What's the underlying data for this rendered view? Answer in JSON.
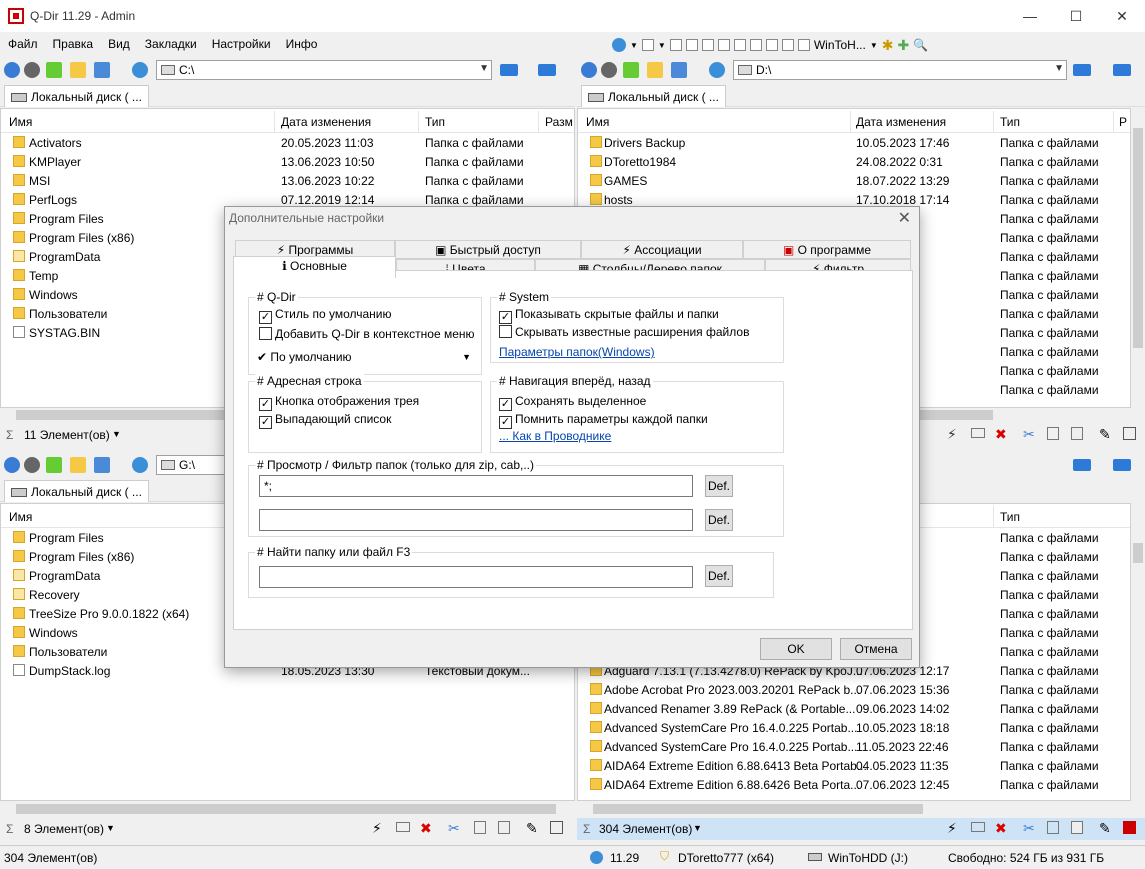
{
  "window": {
    "title": "Q-Dir 11.29 - Admin",
    "minimize": "—",
    "maximize": "☐",
    "close": "✕"
  },
  "menu": [
    "Файл",
    "Правка",
    "Вид",
    "Закладки",
    "Настройки",
    "Инфо"
  ],
  "toolbar": {
    "wintohdd": "WinToH..."
  },
  "pane_tl": {
    "address": "C:\\",
    "tab": "Локальный диск ( ...",
    "cols": [
      "Имя",
      "Дата изменения",
      "Тип",
      "Разм"
    ],
    "rows": [
      {
        "name": "Activators",
        "date": "20.05.2023 11:03",
        "type": "Папка с файлами",
        "icon": "folder"
      },
      {
        "name": "KMPlayer",
        "date": "13.06.2023 10:50",
        "type": "Папка с файлами",
        "icon": "folder"
      },
      {
        "name": "MSI",
        "date": "13.06.2023 10:22",
        "type": "Папка с файлами",
        "icon": "folder"
      },
      {
        "name": "PerfLogs",
        "date": "07.12.2019 12:14",
        "type": "Папка с файлами",
        "icon": "folder"
      },
      {
        "name": "Program Files",
        "date": "",
        "type": "",
        "icon": "folder"
      },
      {
        "name": "Program Files (x86)",
        "date": "",
        "type": "",
        "icon": "folder"
      },
      {
        "name": "ProgramData",
        "date": "",
        "type": "",
        "icon": "light"
      },
      {
        "name": "Temp",
        "date": "",
        "type": "",
        "icon": "folder"
      },
      {
        "name": "Windows",
        "date": "",
        "type": "",
        "icon": "folder"
      },
      {
        "name": "Пользователи",
        "date": "",
        "type": "",
        "icon": "folder"
      },
      {
        "name": "SYSTAG.BIN",
        "date": "",
        "type": "",
        "icon": "file"
      }
    ],
    "status": "11 Элемент(ов)"
  },
  "pane_tr": {
    "address": "D:\\",
    "tab": "Локальный диск ( ...",
    "cols": [
      "Имя",
      "Дата изменения",
      "Тип",
      "Р"
    ],
    "rows": [
      {
        "name": "Drivers Backup",
        "date": "10.05.2023 17:46",
        "type": "Папка с файлами",
        "icon": "folder"
      },
      {
        "name": "DToretto1984",
        "date": "24.08.2022 0:31",
        "type": "Папка с файлами",
        "icon": "folder"
      },
      {
        "name": "GAMES",
        "date": "18.07.2022 13:29",
        "type": "Папка с файлами",
        "icon": "folder"
      },
      {
        "name": "hosts",
        "date": "17.10.2018 17:14",
        "type": "Папка с файлами",
        "icon": "folder"
      },
      {
        "name": "",
        "date": "3:14",
        "type": "Папка с файлами",
        "icon": "none"
      },
      {
        "name": "",
        "date": "0:17",
        "type": "Папка с файлами",
        "icon": "none"
      },
      {
        "name": "",
        "date": "9:29",
        "type": "Папка с файлами",
        "icon": "none"
      },
      {
        "name": "",
        "date": "2:38",
        "type": "Папка с файлами",
        "icon": "none"
      },
      {
        "name": "",
        "date": "1:29",
        "type": "Папка с файлами",
        "icon": "none"
      },
      {
        "name": "",
        "date": "0:40",
        "type": "Папка с файлами",
        "icon": "none"
      },
      {
        "name": "",
        "date": "0:46",
        "type": "Папка с файлами",
        "icon": "none"
      },
      {
        "name": "",
        "date": "4:08",
        "type": "Папка с файлами",
        "icon": "none"
      },
      {
        "name": "",
        "date": "0:18",
        "type": "Папка с файлами",
        "icon": "none"
      },
      {
        "name": "",
        "date": "0:48",
        "type": "Папка с файлами",
        "icon": "none"
      }
    ]
  },
  "pane_bl": {
    "address": "G:\\",
    "tab": "Локальный диск ( ...",
    "cols": [
      "Имя"
    ],
    "rows": [
      {
        "name": "Program Files",
        "date": "",
        "type": "",
        "icon": "folder"
      },
      {
        "name": "Program Files (x86)",
        "date": "",
        "type": "",
        "icon": "folder"
      },
      {
        "name": "ProgramData",
        "date": "",
        "type": "",
        "icon": "light"
      },
      {
        "name": "Recovery",
        "date": "",
        "type": "",
        "icon": "light"
      },
      {
        "name": "TreeSize Pro 9.0.0.1822 (x64)",
        "date": "",
        "type": "",
        "icon": "folder"
      },
      {
        "name": "Windows",
        "date": "",
        "type": "",
        "icon": "folder"
      },
      {
        "name": "Пользователи",
        "date": "",
        "type": "",
        "icon": "folder"
      },
      {
        "name": "DumpStack.log",
        "date": "18.05.2023 13:30",
        "type": "Текстовый докум...",
        "icon": "file"
      }
    ],
    "status": "8 Элемент(ов)"
  },
  "pane_br": {
    "cols": [
      "Тип"
    ],
    "rows": [
      {
        "name": "",
        "date": "0:39",
        "type": "Папка с файлами",
        "icon": "none"
      },
      {
        "name": "",
        "date": "2:15",
        "type": "Папка с файлами",
        "icon": "none"
      },
      {
        "name": "",
        "date": "1:11",
        "type": "Папка с файлами",
        "icon": "none"
      },
      {
        "name": "",
        "date": "9:27",
        "type": "Папка с файлами",
        "icon": "none"
      },
      {
        "name": "",
        "date": "0:37",
        "type": "Папка с файлами",
        "icon": "none"
      },
      {
        "name": "",
        "date": "7:37",
        "type": "Папка с файлами",
        "icon": "none"
      },
      {
        "name": "",
        "date": "1:26",
        "type": "Папка с файлами",
        "icon": "none"
      },
      {
        "name": "Adguard 7.13.1 (7.13.4278.0) RePack by KpoJ...",
        "date": "07.06.2023 12:17",
        "type": "Папка с файлами",
        "icon": "folder"
      },
      {
        "name": "Adobe Acrobat Pro 2023.003.20201 RePack b...",
        "date": "07.06.2023 15:36",
        "type": "Папка с файлами",
        "icon": "folder"
      },
      {
        "name": "Advanced Renamer 3.89 RePack (& Portable...",
        "date": "09.06.2023 14:02",
        "type": "Папка с файлами",
        "icon": "folder"
      },
      {
        "name": "Advanced SystemCare Pro 16.4.0.225 Portab...",
        "date": "10.05.2023 18:18",
        "type": "Папка с файлами",
        "icon": "folder"
      },
      {
        "name": "Advanced SystemCare Pro 16.4.0.225 Portab...",
        "date": "11.05.2023 22:46",
        "type": "Папка с файлами",
        "icon": "folder"
      },
      {
        "name": "AIDA64 Extreme Edition 6.88.6413 Beta Portab...",
        "date": "04.05.2023 11:35",
        "type": "Папка с файлами",
        "icon": "folder"
      },
      {
        "name": "AIDA64 Extreme Edition 6.88.6426 Beta Porta...",
        "date": "07.06.2023 12:45",
        "type": "Папка с файлами",
        "icon": "folder"
      }
    ],
    "status": "304 Элемент(ов)"
  },
  "dialog": {
    "title": "Дополнительные настройки",
    "tabs_row1": [
      "Программы",
      "Быстрый доступ",
      "Ассоциации",
      "О программе"
    ],
    "tabs_row2": [
      "Основные",
      "Цвета",
      "Столбцы/Дерево папок",
      "Фильтр"
    ],
    "qdir": {
      "label": "# Q-Dir",
      "opt1": "Стиль по умолчанию",
      "opt2": "Добавить Q-Dir в контекстное меню",
      "preset": "По умолчанию"
    },
    "system": {
      "label": "# System",
      "opt1": "Показывать скрытые файлы и папки",
      "opt2": "Скрывать известные расширения файлов",
      "link": "Параметры папок(Windows)"
    },
    "addr": {
      "label": "# Адресная строка",
      "opt1": "Кнопка отображения трея",
      "opt2": "Выпадающий список"
    },
    "nav": {
      "label": "# Навигация вперёд, назад",
      "opt1": "Сохранять выделенное",
      "opt2": "Помнить параметры каждой папки",
      "link": "... Как в Проводнике"
    },
    "filter": {
      "label": "# Просмотр / Фильтр папок (только для zip, cab,..)",
      "value1": "*;",
      "value2": "",
      "def": "Def."
    },
    "find": {
      "label": "# Найти папку или файл    F3",
      "value": "",
      "def": "Def."
    },
    "ok": "OK",
    "cancel": "Отмена"
  },
  "statusbar": {
    "count": "304 Элемент(ов)",
    "version": "11.29",
    "user": "DToretto777 (x64)",
    "drive": "WinToHDD (J:)",
    "free": "Свободно: 524 ГБ из 931 ГБ"
  }
}
